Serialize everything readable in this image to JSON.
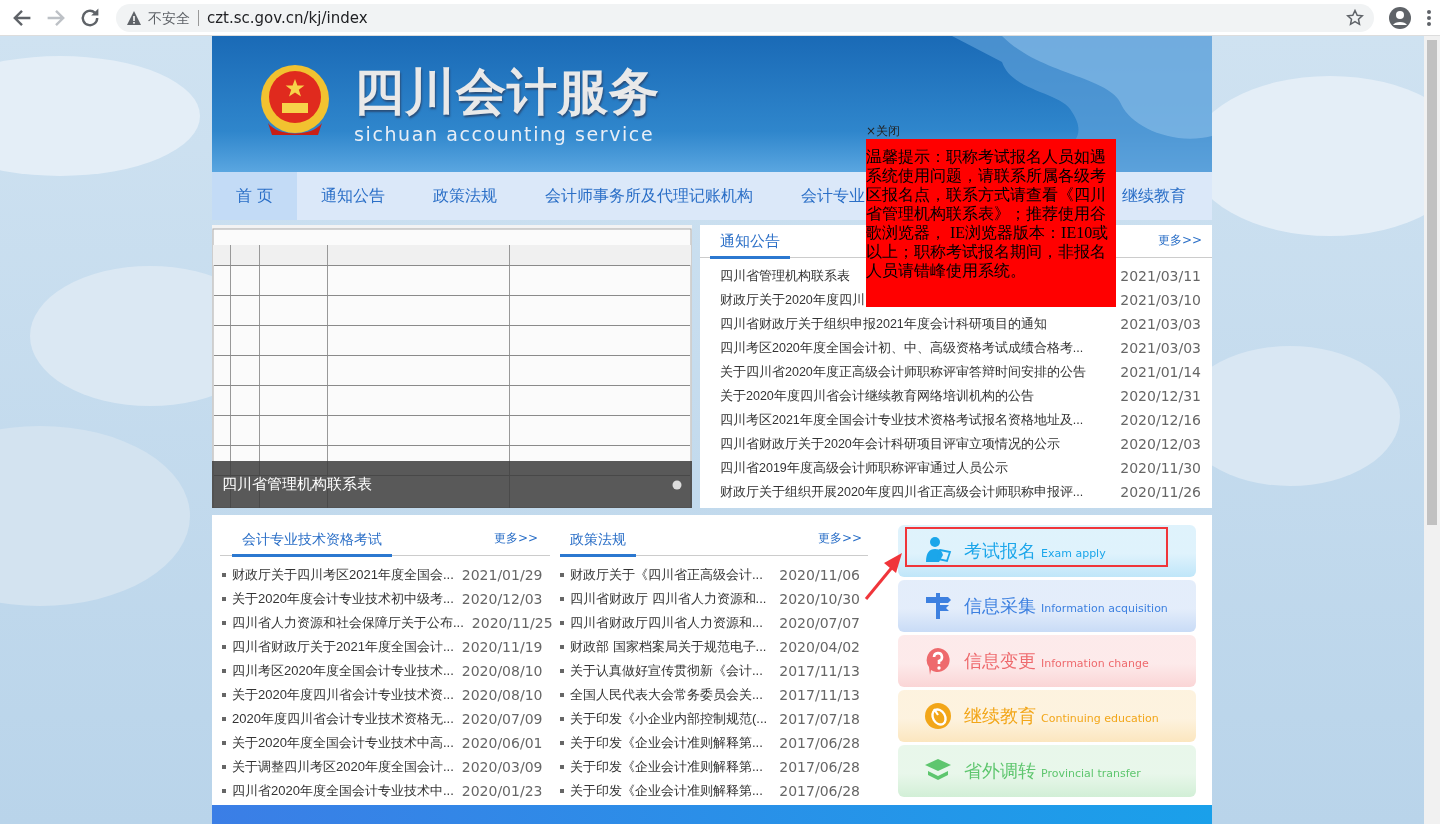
{
  "browser": {
    "security": "不安全",
    "url": "czt.sc.gov.cn/kj/index"
  },
  "header": {
    "title": "四川会计服务",
    "subtitle": "sichuan accounting service"
  },
  "nav": [
    {
      "label": "首 页",
      "selected": true
    },
    {
      "label": "通知公告",
      "selected": false
    },
    {
      "label": "政策法规",
      "selected": false
    },
    {
      "label": "会计师事务所及代理记账机构",
      "selected": false
    },
    {
      "label": "会计专业",
      "selected": false
    },
    {
      "label": "继续教育",
      "selected": false
    }
  ],
  "slideshow": {
    "caption": "四川省管理机构联系表"
  },
  "notices": {
    "title": "通知公告",
    "more": "更多>>",
    "items": [
      {
        "title": "四川省管理机构联系表",
        "date": "2021/03/11"
      },
      {
        "title": "财政厅关于2020年度四川",
        "date": "2021/03/10"
      },
      {
        "title": "四川省财政厅关于组织申报2021年度会计科研项目的通知",
        "date": "2021/03/03"
      },
      {
        "title": "四川考区2020年度全国会计初、中、高级资格考试成绩合格考...",
        "date": "2021/03/03"
      },
      {
        "title": "关于四川省2020年度正高级会计师职称评审答辩时间安排的公告",
        "date": "2021/01/14"
      },
      {
        "title": "关于2020年度四川省会计继续教育网络培训机构的公告",
        "date": "2020/12/31"
      },
      {
        "title": "四川考区2021年度全国会计专业技术资格考试报名资格地址及...",
        "date": "2020/12/16"
      },
      {
        "title": "四川省财政厅关于2020年会计科研项目评审立项情况的公示",
        "date": "2020/12/03"
      },
      {
        "title": "四川省2019年度高级会计师职称评审通过人员公示",
        "date": "2020/11/30"
      },
      {
        "title": "财政厅关于组织开展2020年度四川省正高级会计师职称申报评...",
        "date": "2020/11/26"
      }
    ]
  },
  "exam_news": {
    "title": "会计专业技术资格考试",
    "more": "更多>>",
    "items": [
      {
        "title": "财政厅关于四川考区2021年度全国会...",
        "date": "2021/01/29"
      },
      {
        "title": "关于2020年度会计专业技术初中级考...",
        "date": "2020/12/03"
      },
      {
        "title": "四川省人力资源和社会保障厅关于公布...",
        "date": "2020/11/25"
      },
      {
        "title": "四川省财政厅关于2021年度全国会计...",
        "date": "2020/11/19"
      },
      {
        "title": "四川考区2020年度全国会计专业技术...",
        "date": "2020/08/10"
      },
      {
        "title": "关于2020年度四川省会计专业技术资...",
        "date": "2020/08/10"
      },
      {
        "title": "2020年度四川省会计专业技术资格无...",
        "date": "2020/07/09"
      },
      {
        "title": "关于2020年度全国会计专业技术中高...",
        "date": "2020/06/01"
      },
      {
        "title": "关于调整四川考区2020年度全国会计...",
        "date": "2020/03/09"
      },
      {
        "title": "四川省2020年度全国会计专业技术中...",
        "date": "2020/01/23"
      }
    ]
  },
  "policy_news": {
    "title": "政策法规",
    "more": "更多>>",
    "items": [
      {
        "title": "财政厅关于《四川省正高级会计...",
        "date": "2020/11/06"
      },
      {
        "title": "四川省财政厅 四川省人力资源和...",
        "date": "2020/10/30"
      },
      {
        "title": "四川省财政厅四川省人力资源和...",
        "date": "2020/07/07"
      },
      {
        "title": "财政部 国家档案局关于规范电子...",
        "date": "2020/04/02"
      },
      {
        "title": "关于认真做好宣传贯彻新《会计...",
        "date": "2017/11/13"
      },
      {
        "title": "全国人民代表大会常务委员会关...",
        "date": "2017/11/13"
      },
      {
        "title": "关于印发《小企业内部控制规范(...",
        "date": "2017/07/18"
      },
      {
        "title": "关于印发《企业会计准则解释第...",
        "date": "2017/06/28"
      },
      {
        "title": "关于印发《企业会计准则解释第...",
        "date": "2017/06/28"
      },
      {
        "title": "关于印发《企业会计准则解释第...",
        "date": "2017/06/28"
      }
    ]
  },
  "services": [
    {
      "kind": "exam",
      "title": "考试报名",
      "subtitle": "Exam apply",
      "color": "#1ba6ea",
      "highlighted": true
    },
    {
      "kind": "collect",
      "title": "信息采集",
      "subtitle": "Information acquisition",
      "color": "#3d80e0",
      "highlighted": false
    },
    {
      "kind": "change",
      "title": "信息变更",
      "subtitle": "Information change",
      "color": "#ee6a6d",
      "highlighted": false
    },
    {
      "kind": "education",
      "title": "继续教育",
      "subtitle": "Continuing education",
      "color": "#f2a619",
      "highlighted": false
    },
    {
      "kind": "transfer",
      "title": "省外调转",
      "subtitle": "Provincial transfer",
      "color": "#5ec66e",
      "highlighted": false
    }
  ],
  "popup": {
    "close": "×关闭",
    "message": "温馨提示：职称考试报名人员如遇系统使用问题，请联系所属各级考区报名点，联系方式请查看《四川省管理机构联系表》；推荐使用谷歌浏览器， IE浏览器版本：IE10或以上；职称考试报名期间，非报名人员请错峰使用系统。"
  }
}
